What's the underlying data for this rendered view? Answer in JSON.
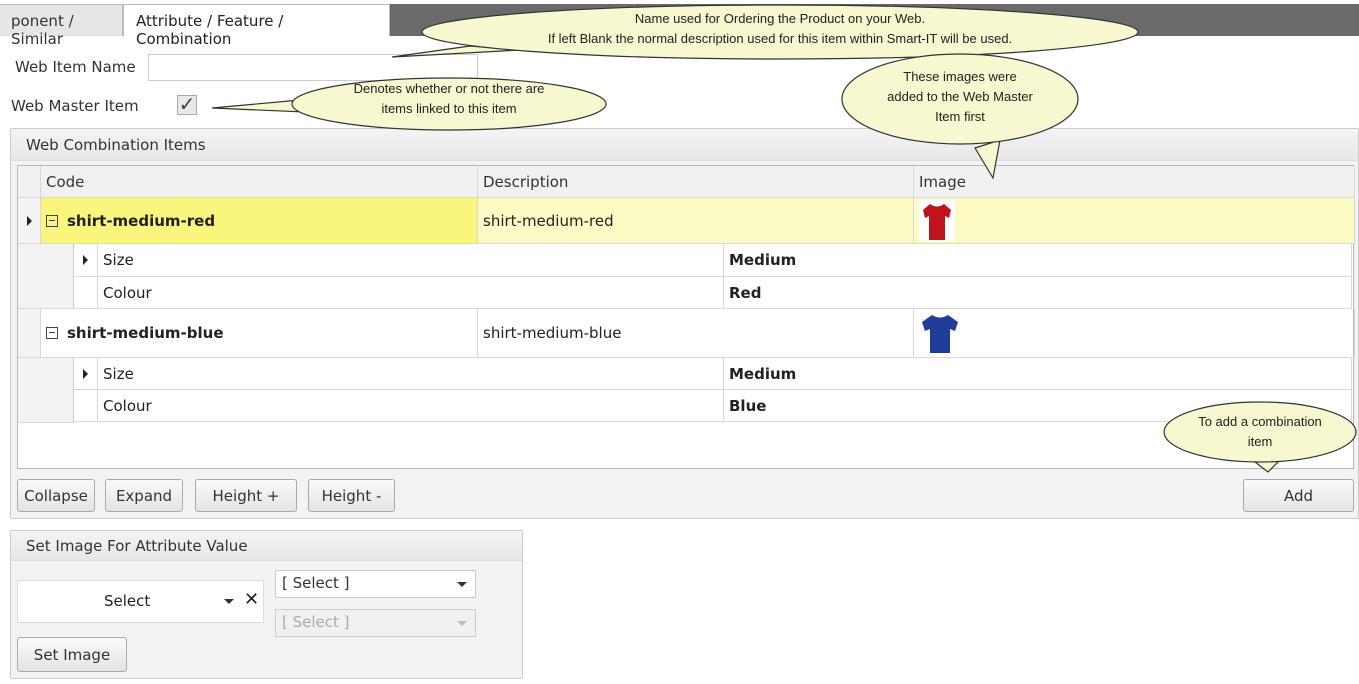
{
  "tabs": [
    {
      "label": "ponent / Similar",
      "active": false
    },
    {
      "label": "Attribute / Feature / Combination",
      "active": true
    }
  ],
  "form": {
    "web_item_name_label": "Web Item Name",
    "web_item_name_value": "",
    "web_master_item_label": "Web Master Item",
    "web_master_item_checked": true
  },
  "combination": {
    "title": "Web Combination Items",
    "columns": [
      "Code",
      "Description",
      "Image"
    ],
    "rows": [
      {
        "code": "shirt-medium-red",
        "description": "shirt-medium-red",
        "image": "red-shirt",
        "selected": true,
        "attributes": [
          {
            "name": "Size",
            "value": "Medium"
          },
          {
            "name": "Colour",
            "value": "Red"
          }
        ]
      },
      {
        "code": "shirt-medium-blue",
        "description": "shirt-medium-blue",
        "image": "blue-shirt",
        "selected": false,
        "attributes": [
          {
            "name": "Size",
            "value": "Medium"
          },
          {
            "name": "Colour",
            "value": "Blue"
          }
        ]
      }
    ],
    "buttons": {
      "collapse": "Collapse",
      "expand": "Expand",
      "height_plus": "Height +",
      "height_minus": "Height -",
      "add": "Add"
    }
  },
  "set_image": {
    "title": "Set Image For Attribute Value",
    "select_value": "Select",
    "dropdown1": "[ Select ]",
    "dropdown2": "[ Select ]",
    "button": "Set Image"
  },
  "callouts": {
    "web_name_1": "Name used for Ordering the Product on your Web.",
    "web_name_2": "If left Blank the normal description used for this item within Smart-IT will be used.",
    "master_1": "Denotes whether or not there are",
    "master_2": "items linked to this item",
    "images_1": "These images were",
    "images_2": "added to the Web Master",
    "images_3": "Item first",
    "add_1": "To add a combination",
    "add_2": "item"
  },
  "colors": {
    "selected_code": "#faf57c",
    "selected_row": "#fdfbc4",
    "callout": "#f7f7d0",
    "shirt_red": "#c0141c",
    "shirt_blue": "#1f3e9a"
  }
}
